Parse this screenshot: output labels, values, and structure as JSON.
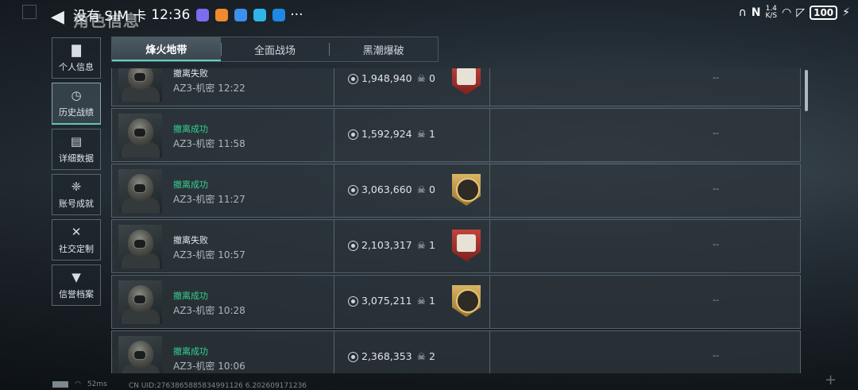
{
  "status_bar": {
    "carrier": "没有 SIM 卡",
    "time": "12:36",
    "more": "···",
    "net_speed_top": "1.4",
    "net_speed_bottom": "K/S",
    "battery": "100"
  },
  "header": {
    "title": "角色信息",
    "back_icon": "back-arrow-icon"
  },
  "sidebar": {
    "items": [
      {
        "label": "个人信息",
        "icon": "bar-chart-icon",
        "active": false
      },
      {
        "label": "历史战绩",
        "icon": "history-clock-icon",
        "active": true
      },
      {
        "label": "详细数据",
        "icon": "folder-icon",
        "active": false
      },
      {
        "label": "账号成就",
        "icon": "medal-icon",
        "active": false
      },
      {
        "label": "社交定制",
        "icon": "tools-icon",
        "active": false
      },
      {
        "label": "信誉档案",
        "icon": "shield-icon",
        "active": false
      }
    ]
  },
  "tabs": [
    {
      "label": "烽火地带",
      "active": true
    },
    {
      "label": "全面战场",
      "active": false
    },
    {
      "label": "黑潮爆破",
      "active": false
    }
  ],
  "records": [
    {
      "outcome": "撤离失败",
      "result": "fail",
      "map": "AZ3-机密",
      "time": "12:22",
      "value": "1,948,940",
      "kills": "0",
      "badge": "red",
      "extra": "--"
    },
    {
      "outcome": "撤离成功",
      "result": "success",
      "map": "AZ3-机密",
      "time": "11:58",
      "value": "1,592,924",
      "kills": "1",
      "badge": "",
      "extra": "--"
    },
    {
      "outcome": "撤离成功",
      "result": "success",
      "map": "AZ3-机密",
      "time": "11:27",
      "value": "3,063,660",
      "kills": "0",
      "badge": "gold",
      "extra": "--"
    },
    {
      "outcome": "撤离失败",
      "result": "fail",
      "map": "AZ3-机密",
      "time": "10:57",
      "value": "2,103,317",
      "kills": "1",
      "badge": "red",
      "extra": "--"
    },
    {
      "outcome": "撤离成功",
      "result": "success",
      "map": "AZ3-机密",
      "time": "10:28",
      "value": "3,075,211",
      "kills": "1",
      "badge": "gold",
      "extra": "--"
    },
    {
      "outcome": "撤离成功",
      "result": "success",
      "map": "AZ3-机密",
      "time": "10:06",
      "value": "2,368,353",
      "kills": "2",
      "badge": "",
      "extra": "--"
    }
  ],
  "footer": {
    "ping": "52ms",
    "uid": "CN UID:2763865885834991126 6.202609171236"
  },
  "colors": {
    "success": "#35d08f",
    "accent": "#62d0bf"
  }
}
